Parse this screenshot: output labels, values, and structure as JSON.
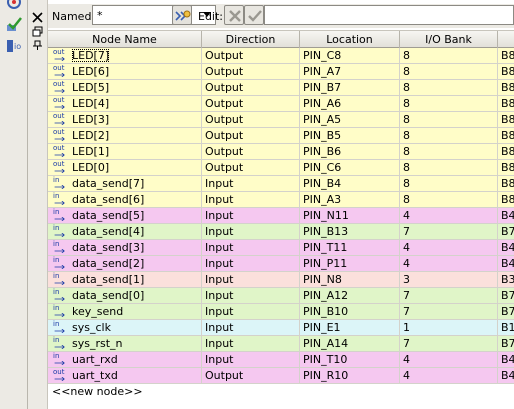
{
  "filter": {
    "named_label": "Named:",
    "named_value": "*",
    "edit_label": "Edit:",
    "edit_value": ""
  },
  "table": {
    "columns": [
      "Node Name",
      "Direction",
      "Location",
      "I/O Bank",
      ""
    ],
    "rows": [
      {
        "type": "out",
        "name": "LED[7]",
        "direction": "Output",
        "location": "PIN_C8",
        "bank": "8",
        "extra": "B8",
        "color": "#fffdc8",
        "selected": true
      },
      {
        "type": "out",
        "name": "LED[6]",
        "direction": "Output",
        "location": "PIN_A7",
        "bank": "8",
        "extra": "B8",
        "color": "#fffdc8"
      },
      {
        "type": "out",
        "name": "LED[5]",
        "direction": "Output",
        "location": "PIN_B7",
        "bank": "8",
        "extra": "B8",
        "color": "#fffdc8"
      },
      {
        "type": "out",
        "name": "LED[4]",
        "direction": "Output",
        "location": "PIN_A6",
        "bank": "8",
        "extra": "B8",
        "color": "#fffdc8"
      },
      {
        "type": "out",
        "name": "LED[3]",
        "direction": "Output",
        "location": "PIN_A5",
        "bank": "8",
        "extra": "B8",
        "color": "#fffdc8"
      },
      {
        "type": "out",
        "name": "LED[2]",
        "direction": "Output",
        "location": "PIN_B5",
        "bank": "8",
        "extra": "B8",
        "color": "#fffdc8"
      },
      {
        "type": "out",
        "name": "LED[1]",
        "direction": "Output",
        "location": "PIN_B6",
        "bank": "8",
        "extra": "B8",
        "color": "#fffdc8"
      },
      {
        "type": "out",
        "name": "LED[0]",
        "direction": "Output",
        "location": "PIN_C6",
        "bank": "8",
        "extra": "B8",
        "color": "#fffdc8"
      },
      {
        "type": "in",
        "name": "data_send[7]",
        "direction": "Input",
        "location": "PIN_B4",
        "bank": "8",
        "extra": "B8",
        "color": "#fffdc8"
      },
      {
        "type": "in",
        "name": "data_send[6]",
        "direction": "Input",
        "location": "PIN_A3",
        "bank": "8",
        "extra": "B8",
        "color": "#fffdc8"
      },
      {
        "type": "in",
        "name": "data_send[5]",
        "direction": "Input",
        "location": "PIN_N11",
        "bank": "4",
        "extra": "B4",
        "color": "#f5c8f0"
      },
      {
        "type": "in",
        "name": "data_send[4]",
        "direction": "Input",
        "location": "PIN_B13",
        "bank": "7",
        "extra": "B7",
        "color": "#e0f5c8"
      },
      {
        "type": "in",
        "name": "data_send[3]",
        "direction": "Input",
        "location": "PIN_T11",
        "bank": "4",
        "extra": "B4",
        "color": "#f5c8f0"
      },
      {
        "type": "in",
        "name": "data_send[2]",
        "direction": "Input",
        "location": "PIN_P11",
        "bank": "4",
        "extra": "B4",
        "color": "#f5c8f0"
      },
      {
        "type": "in",
        "name": "data_send[1]",
        "direction": "Input",
        "location": "PIN_N8",
        "bank": "3",
        "extra": "B3",
        "color": "#fbe0dc"
      },
      {
        "type": "in",
        "name": "data_send[0]",
        "direction": "Input",
        "location": "PIN_A12",
        "bank": "7",
        "extra": "B7",
        "color": "#e0f5c8"
      },
      {
        "type": "in",
        "name": "key_send",
        "direction": "Input",
        "location": "PIN_B10",
        "bank": "7",
        "extra": "B7",
        "color": "#e0f5c8"
      },
      {
        "type": "in",
        "name": "sys_clk",
        "direction": "Input",
        "location": "PIN_E1",
        "bank": "1",
        "extra": "B1",
        "color": "#dcf5f8"
      },
      {
        "type": "in",
        "name": "sys_rst_n",
        "direction": "Input",
        "location": "PIN_A14",
        "bank": "7",
        "extra": "B7",
        "color": "#e0f5c8"
      },
      {
        "type": "in",
        "name": "uart_rxd",
        "direction": "Input",
        "location": "PIN_T10",
        "bank": "4",
        "extra": "B4",
        "color": "#f5c8f0"
      },
      {
        "type": "out",
        "name": "uart_txd",
        "direction": "Output",
        "location": "PIN_R10",
        "bank": "4",
        "extra": "B4",
        "color": "#f5c8f0"
      }
    ],
    "new_node_label": "<<new node>>"
  },
  "icons": {
    "toolbar": [
      "pin-planner-icon",
      "check-mark-icon",
      "io-assignment-icon"
    ],
    "gutter": [
      "close-icon",
      "restore-window-icon",
      "pin-window-icon"
    ]
  }
}
